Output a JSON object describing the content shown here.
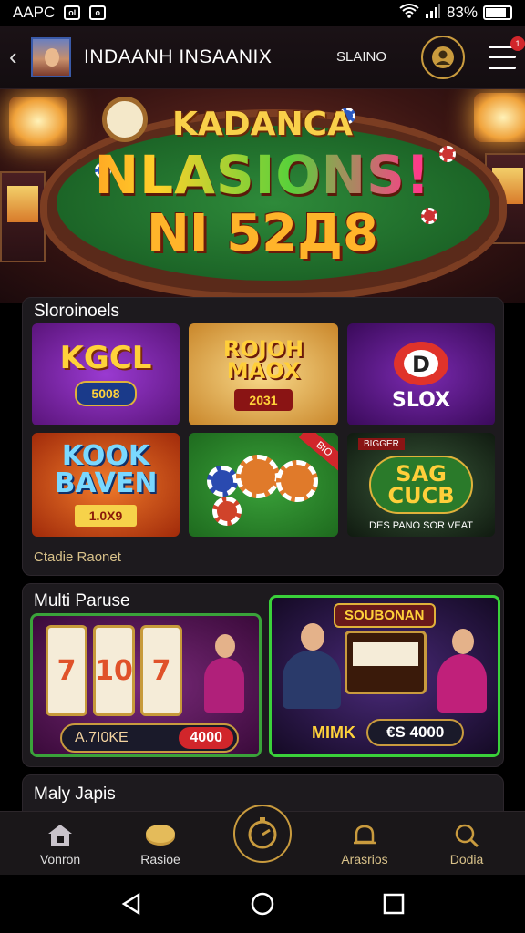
{
  "status_bar": {
    "carrier": "AAPC",
    "box1": "ol",
    "box2": "o",
    "battery": "83%",
    "battery_level": 0.83
  },
  "header": {
    "title": "INDAANH INSAANIX",
    "subtitle": "SLAINO"
  },
  "hero": {
    "line1": "KADANCA",
    "line2": "NLASIONS!",
    "line3": "NI 52Д8"
  },
  "section1": {
    "title": "Sloroinoels",
    "tiles": [
      {
        "main": "KGCL",
        "pill": "5008"
      },
      {
        "main": "ROJOH\nMAOX",
        "pill": "2031"
      },
      {
        "main": "SLOX"
      },
      {
        "main": "KOOK\nBAVEN",
        "pill": "1.0Х9"
      },
      {
        "ribbon": "BIO"
      },
      {
        "top": "BIGGER",
        "main": "SAG\nCUCB",
        "caption": "DES PANO SOR VEAT"
      }
    ],
    "footer": "Ctadie Raonet"
  },
  "section2": {
    "title": "Multi Paruse",
    "promo1": {
      "reels": [
        "7",
        "10",
        "7"
      ],
      "amount_label": "A.7I0KE",
      "amount_value": "4000"
    },
    "promo2": {
      "banner": "SOUBONAN",
      "label": "MIMK",
      "value": "€S 4000"
    }
  },
  "section3": {
    "title": "Maly Japis"
  },
  "bottom_nav": [
    {
      "label": "Vonron",
      "icon": "home-icon"
    },
    {
      "label": "Rasioe",
      "icon": "coin-icon"
    },
    {
      "label": "",
      "icon": "timer-icon"
    },
    {
      "label": "Arasrios",
      "icon": "bell-icon"
    },
    {
      "label": "Dodia",
      "icon": "search-icon"
    }
  ],
  "colors": {
    "accent_gold": "#c99b3e",
    "badge_red": "#d1262b",
    "panel_bg": "#1d1a1e"
  }
}
